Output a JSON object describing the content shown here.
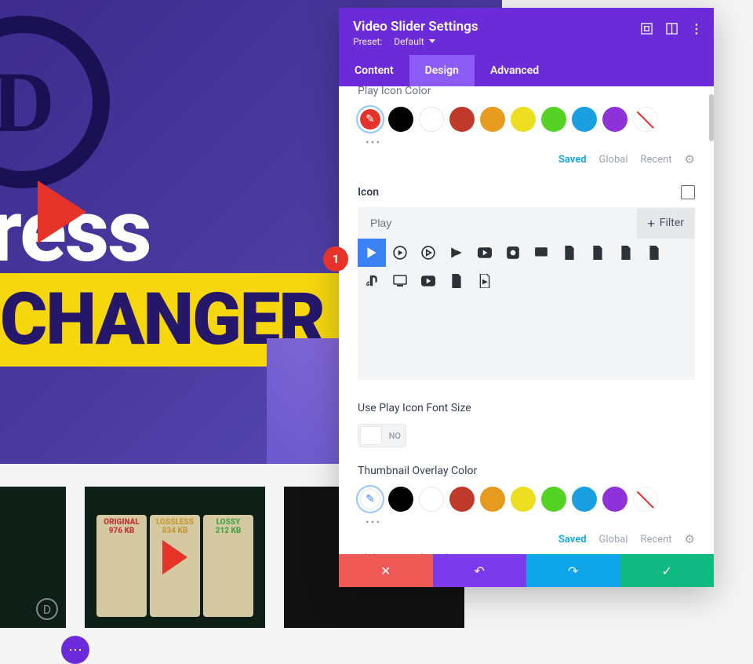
{
  "splash": {
    "text_press": "rdPress",
    "text_changer": "CHANGER"
  },
  "thumbs": {
    "cat_a": {
      "t": "ORIGINAL",
      "s": "976 KB"
    },
    "cat_b": {
      "t": "LOSSLESS",
      "s": "834 KB"
    },
    "cat_c": {
      "t": "LOSSY",
      "s": "212 KB"
    }
  },
  "badge": "1",
  "panel": {
    "title": "Video Slider Settings",
    "preset_label": "Preset:",
    "preset_value": "Default",
    "tabs": {
      "content": "Content",
      "design": "Design",
      "advanced": "Advanced"
    },
    "play_icon_color": "Play Icon Color",
    "saved": "Saved",
    "global": "Global",
    "recent": "Recent",
    "icon_section": "Icon",
    "search_value": "Play",
    "filter": "Filter",
    "use_font": "Use Play Icon Font Size",
    "toggle_no": "NO",
    "thumb_overlay": "Thumbnail Overlay Color",
    "slider_controls": "Slider Controls Color",
    "colors": [
      "#000000",
      "#ffffff",
      "#bf3a2b",
      "#e69b1e",
      "#edde21",
      "#54d324",
      "#1a9fe0",
      "#8e33d9"
    ]
  }
}
